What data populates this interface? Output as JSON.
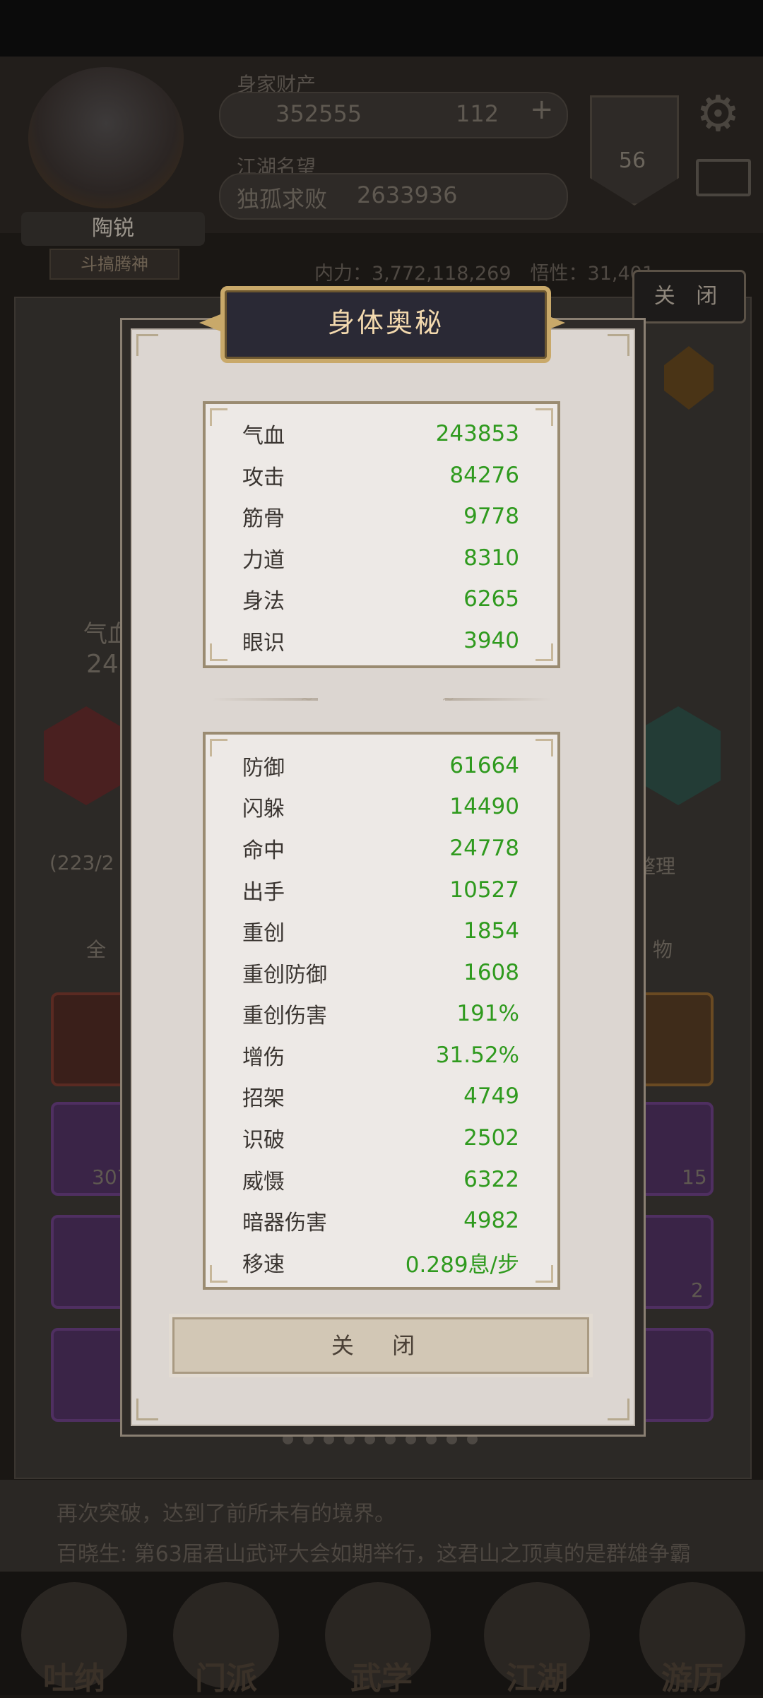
{
  "player": {
    "name": "陶锐",
    "title": "斗搞腾神",
    "wealth_label": "身家财产",
    "silver": "352555",
    "jade": "112",
    "plus": "+",
    "fame_label": "江湖名望",
    "fame_rank": "独孤求败",
    "fame_value": "2633936",
    "level": "56"
  },
  "background": {
    "power_line": "内力：3,772,118,269　悟性：31,401",
    "close_label": "关 闭",
    "hp_short": "气血",
    "hp_short_value": "24",
    "inventory_count": "(223/2",
    "sort_label": "整理",
    "filter_all": "全",
    "filter_items": "物",
    "slot_counts": [
      "307",
      "15",
      "2"
    ],
    "news_lines": [
      "再次突破，达到了前所未有的境界。",
      "百晓生: 第63届君山武评大会如期举行，这君山之顶真的是群雄争霸"
    ],
    "nav": [
      "吐纳",
      "门派",
      "武学",
      "江湖",
      "游历"
    ]
  },
  "dialog": {
    "title": "身体奥秘",
    "primary_stats": [
      {
        "label": "气血",
        "value": "243853"
      },
      {
        "label": "攻击",
        "value": "84276"
      },
      {
        "label": "筋骨",
        "value": "9778"
      },
      {
        "label": "力道",
        "value": "8310"
      },
      {
        "label": "身法",
        "value": "6265"
      },
      {
        "label": "眼识",
        "value": "3940"
      }
    ],
    "secondary_stats": [
      {
        "label": "防御",
        "value": "61664"
      },
      {
        "label": "闪躲",
        "value": "14490"
      },
      {
        "label": "命中",
        "value": "24778"
      },
      {
        "label": "出手",
        "value": "10527"
      },
      {
        "label": "重创",
        "value": "1854"
      },
      {
        "label": "重创防御",
        "value": "1608"
      },
      {
        "label": "重创伤害",
        "value": "191%"
      },
      {
        "label": "增伤",
        "value": "31.52%"
      },
      {
        "label": "招架",
        "value": "4749"
      },
      {
        "label": "识破",
        "value": "2502"
      },
      {
        "label": "威慑",
        "value": "6322"
      },
      {
        "label": "暗器伤害",
        "value": "4982"
      },
      {
        "label": "移速",
        "value": "0.289息/步"
      }
    ],
    "close_button": "关 闭"
  },
  "colors": {
    "stat_value": "#2f9a1e",
    "title_text": "#f3d9ae",
    "title_border": "#c9a96a"
  }
}
